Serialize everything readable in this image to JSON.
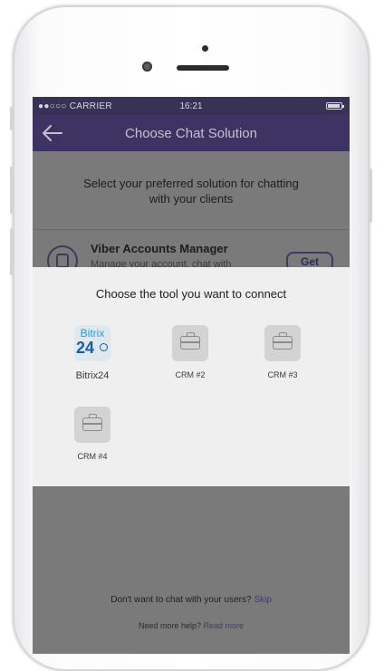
{
  "status_bar": {
    "carrier": "●●○○○ CARRIER",
    "time": "16:21"
  },
  "nav": {
    "title": "Choose Chat Solution",
    "back_icon": "arrow-left-icon"
  },
  "intro": {
    "line1": "Select your preferred solution for chatting",
    "line2": "with your clients"
  },
  "viber_accounts_manager": {
    "title": "Viber Accounts Manager",
    "description": "Manage your account, chat with",
    "button_label": "Get"
  },
  "modal": {
    "title": "Choose the tool you want to connect",
    "tools": [
      {
        "label": "Bitrix24",
        "icon": "bitrix24-logo"
      },
      {
        "label": "CRM #2",
        "icon": "briefcase-icon"
      },
      {
        "label": "CRM #3",
        "icon": "briefcase-icon"
      },
      {
        "label": "CRM #4",
        "icon": "briefcase-icon"
      }
    ],
    "bitrix_logo_text": {
      "word": "Bitrix",
      "number": "24"
    }
  },
  "footer": {
    "skip_prompt": "Don't want to chat with your users?",
    "skip_link": "Skip",
    "help_prompt": "Need more help?",
    "help_link": "Read more"
  },
  "colors": {
    "nav_purple": "#3e3463",
    "overlay_gray": "#7a7a7a",
    "modal_bg": "#efefef",
    "link": "#3e3a7a"
  }
}
